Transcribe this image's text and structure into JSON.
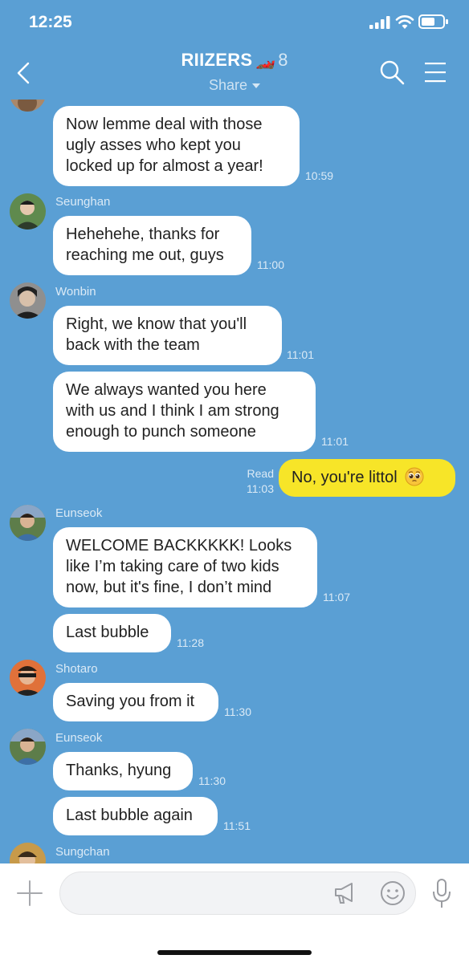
{
  "status_bar": {
    "time": "12:25"
  },
  "header": {
    "title": "RIIZERS",
    "title_icon": "race-car-emoji",
    "member_count": "8",
    "share_label": "Share"
  },
  "messages": [
    {
      "sender": "",
      "text_lines": [
        "Now lemme deal with those",
        "ugly asses who kept you",
        "locked up for almost a year!"
      ],
      "time": "10:59"
    },
    {
      "sender": "Seunghan",
      "text_lines": [
        "Hehehehe, thanks for",
        "reaching me out, guys"
      ],
      "time": "11:00"
    },
    {
      "sender": "Wonbin",
      "text_lines": [
        "Right, we know that you'll",
        "back with the team"
      ],
      "time": "11:01"
    },
    {
      "sender": "",
      "text_lines": [
        "We always wanted you here",
        "with us and I think I am strong",
        "enough to punch someone"
      ],
      "time": "11:01"
    },
    {
      "sender": "me",
      "text_lines": [
        "No, you're littol"
      ],
      "emoji": "pleading-face",
      "read_label": "Read",
      "time": "11:03"
    },
    {
      "sender": "Eunseok",
      "text_lines": [
        "WELCOME BACKKKKK! Looks",
        "like I’m taking care of two kids",
        "now, but it's fine, I don’t mind"
      ],
      "time": "11:07"
    },
    {
      "sender": "",
      "text_lines": [
        "Last bubble"
      ],
      "time": "11:28"
    },
    {
      "sender": "Shotaro",
      "text_lines": [
        "Saving you from it"
      ],
      "time": "11:30"
    },
    {
      "sender": "Eunseok",
      "text_lines": [
        "Thanks, hyung"
      ],
      "time": "11:30"
    },
    {
      "sender": "",
      "text_lines": [
        "Last bubble again"
      ],
      "time": "11:51"
    },
    {
      "sender": "Sungchan",
      "text_lines": [],
      "time": ""
    }
  ],
  "colors": {
    "background": "#5a9fd4",
    "my_bubble": "#f7e528",
    "other_bubble": "#ffffff"
  },
  "input_bar": {
    "left_icon": "plus-icon",
    "right_icons": [
      "megaphone-icon",
      "emoji-icon",
      "mic-icon"
    ]
  }
}
